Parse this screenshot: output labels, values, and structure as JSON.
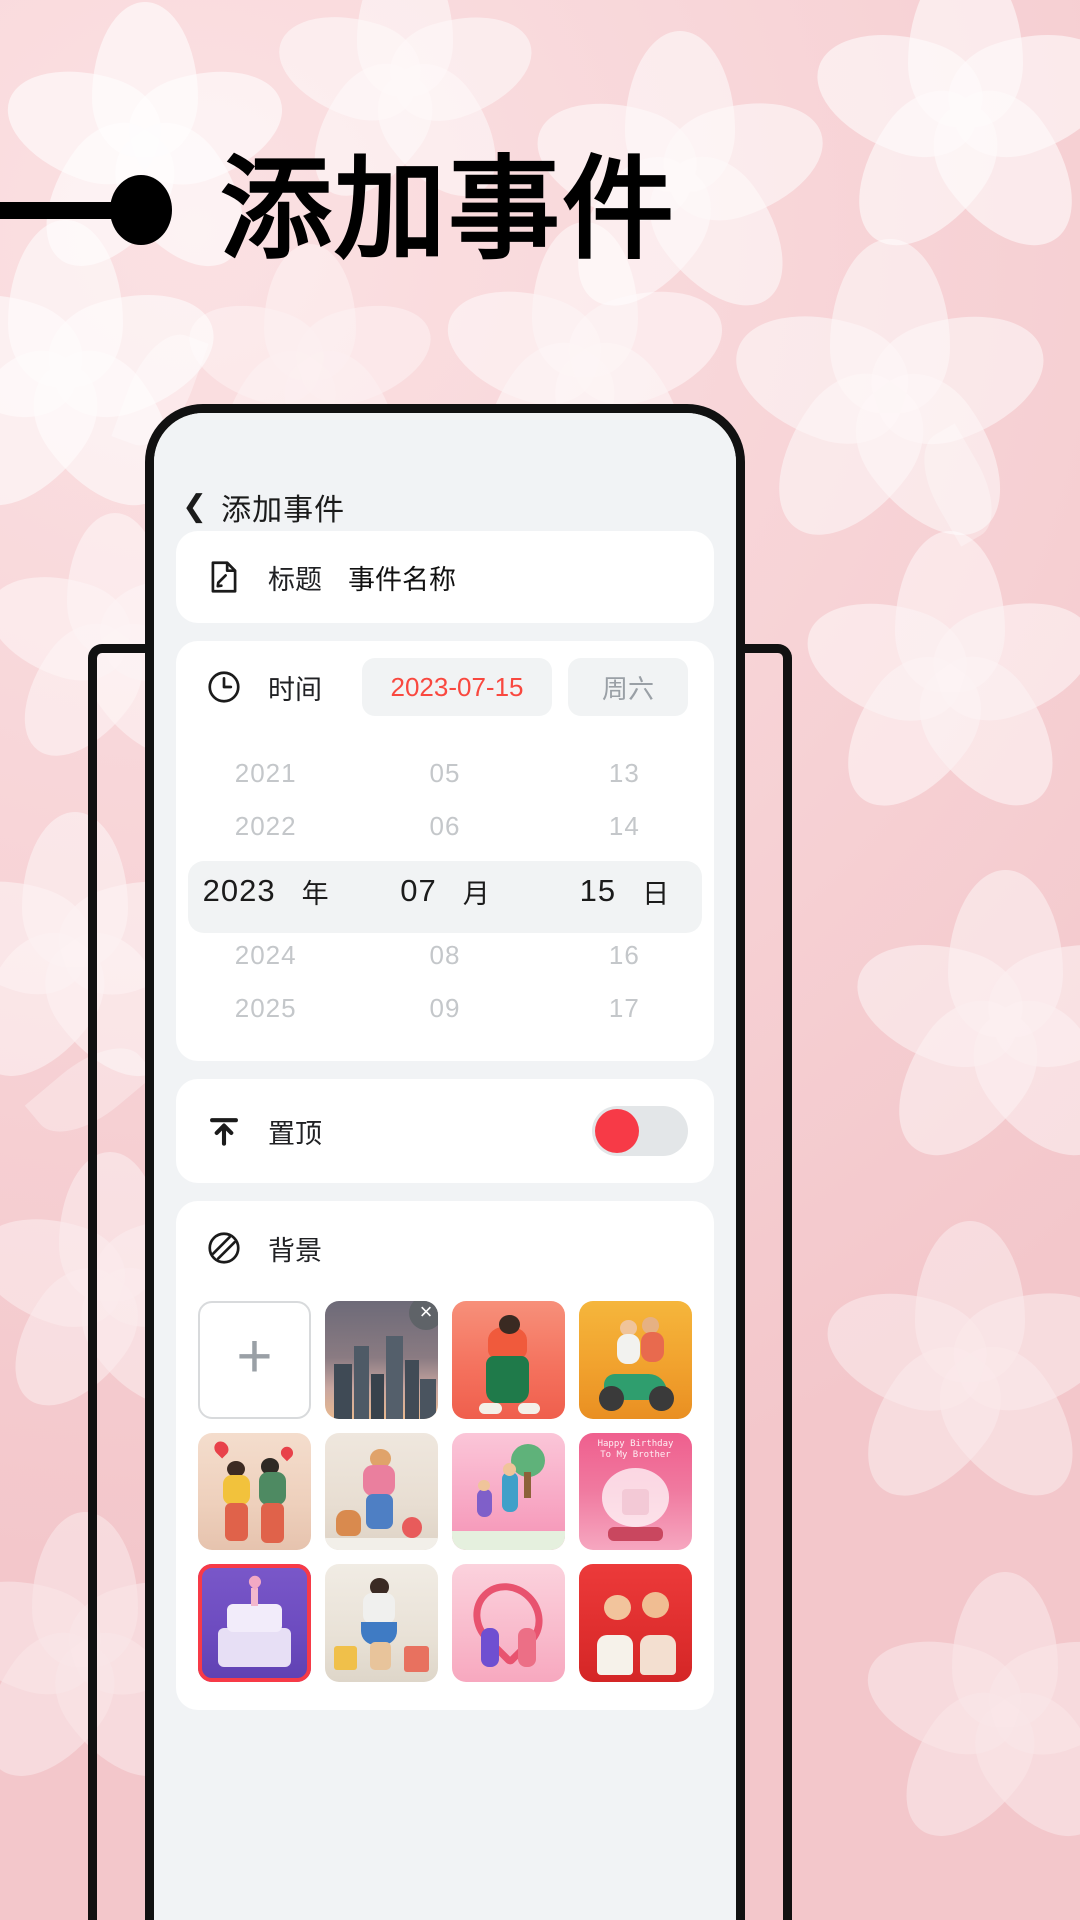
{
  "poster": {
    "headline": "添加事件",
    "decoration": "line-dot"
  },
  "colors": {
    "background_pink": "#f4cace",
    "accent_red": "#f73a47",
    "date_red": "#f9483f",
    "muted_gray": "#9aa0a6",
    "card_white": "#ffffff",
    "screen_gray": "#f1f3f5"
  },
  "phone": {
    "navbar": {
      "back_icon": "chevron-left-icon",
      "title": "添加事件"
    },
    "title_row": {
      "icon": "document-edit-icon",
      "label": "标题",
      "placeholder": "事件名称",
      "value": "事件名称"
    },
    "time_row": {
      "icon": "clock-icon",
      "label": "时间",
      "date_value": "2023-07-15",
      "weekday_value": "周六"
    },
    "date_picker": {
      "units": {
        "year": "年",
        "month": "月",
        "day": "日"
      },
      "selected": {
        "year": "2023",
        "month": "07",
        "day": "15"
      },
      "rows": [
        {
          "year": "2021",
          "month": "05",
          "day": "13"
        },
        {
          "year": "2022",
          "month": "06",
          "day": "14"
        },
        {
          "year": "2023",
          "month": "07",
          "day": "15"
        },
        {
          "year": "2024",
          "month": "08",
          "day": "16"
        },
        {
          "year": "2025",
          "month": "09",
          "day": "17"
        }
      ]
    },
    "pin_row": {
      "icon": "pin-to-top-icon",
      "label": "置顶",
      "toggle_on": "true"
    },
    "background_section": {
      "icon": "image-pattern-icon",
      "label": "背景",
      "add_label": "+",
      "thumbnails": [
        {
          "name": "add-background",
          "kind": "add"
        },
        {
          "name": "city-skyline",
          "kind": "image",
          "removable": "true",
          "remove_label": "×"
        },
        {
          "name": "dancing-person-orange",
          "kind": "image"
        },
        {
          "name": "scooter-couple",
          "kind": "image"
        },
        {
          "name": "couple-with-hearts",
          "kind": "image"
        },
        {
          "name": "woman-with-pets",
          "kind": "image"
        },
        {
          "name": "family-park-walk",
          "kind": "image"
        },
        {
          "name": "birthday-snowglobe",
          "kind": "image",
          "caption": "Happy Birthday\nTo My Brother"
        },
        {
          "name": "birthday-cake-purple",
          "kind": "image",
          "selected": "true"
        },
        {
          "name": "woman-shopping",
          "kind": "image"
        },
        {
          "name": "heart-couple-pink",
          "kind": "image"
        },
        {
          "name": "happy-couple-red",
          "kind": "image"
        }
      ]
    }
  }
}
